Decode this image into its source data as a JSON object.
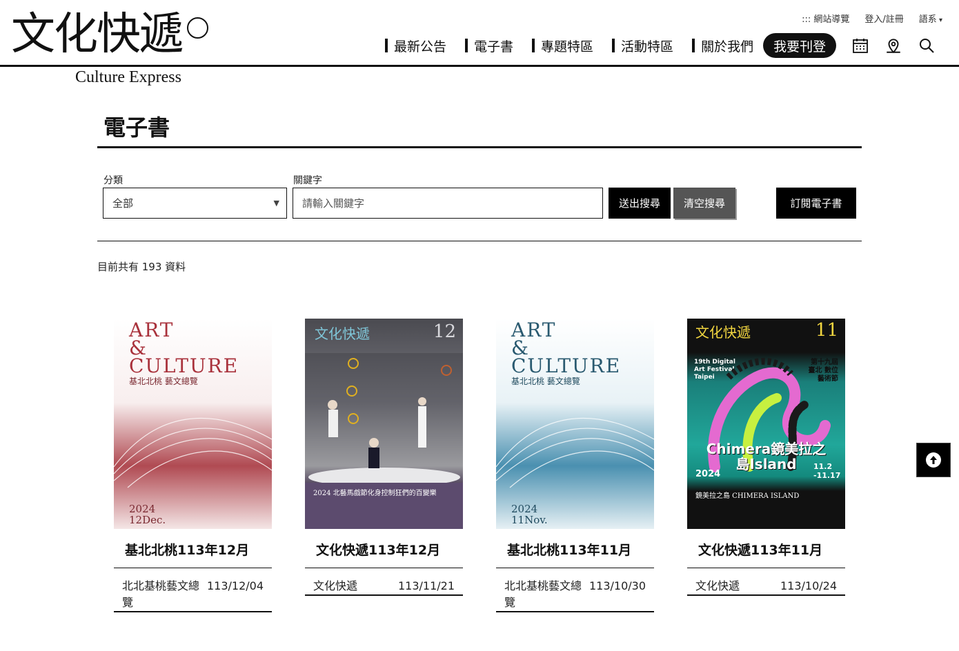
{
  "header": {
    "logo_zh": "文化快遞",
    "logo_en": "Culture Express",
    "util": {
      "sitemap": "::: 網站導覽",
      "login": "登入/註冊",
      "lang": "語系"
    },
    "nav": [
      "最新公告",
      "電子書",
      "專題特區",
      "活動特區",
      "關於我們"
    ],
    "publish": "我要刊登",
    "icons": [
      "calendar-icon",
      "map-pin-icon",
      "search-icon"
    ]
  },
  "page": {
    "title": "電子書"
  },
  "search": {
    "category_label": "分類",
    "category_value": "全部",
    "keyword_label": "關鍵字",
    "keyword_placeholder": "請輸入關鍵字",
    "keyword_value": "",
    "submit": "送出搜尋",
    "clear": "清空搜尋",
    "subscribe": "訂閱電子書"
  },
  "count_text": "目前共有 193 資料",
  "cards": [
    {
      "title": "基北北桃113年12月",
      "publisher": "北北基桃藝文總覽",
      "date": "113/12/04",
      "cover": {
        "lines": [
          "ART",
          "&",
          "CULTURE"
        ],
        "sub": "基北北桃 藝文總覽",
        "year": "2024",
        "month": "12Dec."
      }
    },
    {
      "title": "文化快遞113年12月",
      "publisher": "文化快遞",
      "date": "113/11/21",
      "cover": {
        "brand": "文化快遞",
        "num": "12",
        "caption": "2024 北藝馬戲節化身控制狂們的百變樂"
      }
    },
    {
      "title": "基北北桃113年11月",
      "publisher": "北北基桃藝文總覽",
      "date": "113/10/30",
      "cover": {
        "lines": [
          "ART",
          "&",
          "CULTURE"
        ],
        "sub": "基北北桃 藝文總覽",
        "year": "2024",
        "month": "11Nov."
      }
    },
    {
      "title": "文化快遞113年11月",
      "publisher": "文化快遞",
      "date": "113/10/24",
      "cover": {
        "brand": "文化快遞",
        "num": "11",
        "fest_en": "19th Digital Art Festival Taipei",
        "fest_zh": "第十九屆 臺北 數位藝術節",
        "big": "Chimera鏡美拉之島Island",
        "year": "2024",
        "dates": "11.2 -11.17",
        "caption": "鏡美拉之島 CHIMERA ISLAND"
      }
    }
  ]
}
